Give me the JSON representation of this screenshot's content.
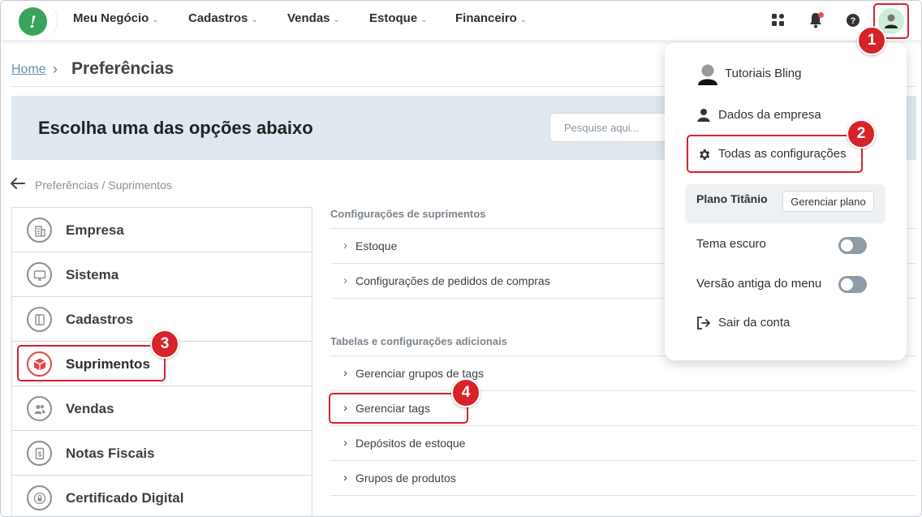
{
  "nav": {
    "items": [
      {
        "label": "Meu Negócio"
      },
      {
        "label": "Cadastros"
      },
      {
        "label": "Vendas"
      },
      {
        "label": "Estoque"
      },
      {
        "label": "Financeiro"
      }
    ],
    "chevron": "⌄"
  },
  "breadcrumb": {
    "home": "Home",
    "separator": "›",
    "current": "Preferências"
  },
  "banner": {
    "title": "Escolha uma das opções abaixo",
    "search_placeholder": "Pesquise aqui..."
  },
  "back": {
    "path": "Preferências / Suprimentos"
  },
  "categories": [
    {
      "label": "Empresa"
    },
    {
      "label": "Sistema"
    },
    {
      "label": "Cadastros"
    },
    {
      "label": "Suprimentos"
    },
    {
      "label": "Vendas"
    },
    {
      "label": "Notas Fiscais"
    },
    {
      "label": "Certificado Digital"
    }
  ],
  "sections": [
    {
      "title": "Configurações de suprimentos",
      "items": [
        {
          "label": "Estoque"
        },
        {
          "label": "Configurações de pedidos de compras"
        }
      ]
    },
    {
      "title": "Tabelas e configurações adicionais",
      "items": [
        {
          "label": "Gerenciar grupos de tags"
        },
        {
          "label": "Gerenciar tags"
        },
        {
          "label": "Depósitos de estoque"
        },
        {
          "label": "Grupos de produtos"
        }
      ]
    }
  ],
  "dropdown": {
    "user_name": "Tutoriais Bling",
    "company": "Dados da empresa",
    "all_settings": "Todas as configurações",
    "plan_name": "Plano Titânio",
    "manage_plan": "Gerenciar plano",
    "dark_theme": "Tema escuro",
    "old_menu": "Versão antiga do menu",
    "logout": "Sair da conta"
  },
  "annotations": [
    "1",
    "2",
    "3",
    "4"
  ],
  "colors": {
    "brand_green": "#3aa35b",
    "highlight_red": "#d6232a",
    "banner_bg": "#dfe8ee",
    "active_arrow_green": "#3aa35b"
  }
}
